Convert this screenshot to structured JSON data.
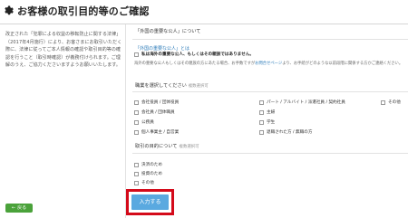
{
  "header": {
    "title": "お客様の取引目的等のご確認"
  },
  "notice": {
    "text": "改正された「犯罪による収益の移転防止に関する法律」（2017年4月施行）により、お客さまにお取引いただく際に、法律に従ってご本人情報の確認や取引目的等の確認を行うこと（取引時確認）が義務付けられます。ご理解のうえ、ご協力くださいますようお願いいたします。"
  },
  "back_button": {
    "label": "戻る"
  },
  "pep": {
    "heading": "「外国の重要な公人」について",
    "link": "「外国の重要な公人」とは",
    "declaration": "私は海外の重要な公人、もしくはその親族ではありません。",
    "note_pre": "海外の重要な公人もしくはその親族の方にあたる場合、お手数ですが",
    "note_link": "お問合せページ",
    "note_post": "より、お手続がどのような以前段階に関係する方かご連絡ください。"
  },
  "occupation": {
    "heading": "職業を選択してください",
    "sub": "複数選択可",
    "options": [
      "会社役員 / 団体役員",
      "会社員 / 団体職員",
      "公務員",
      "個人事業主 / 自営業",
      "パート / アルバイト / 派遣社員 / 契約社員",
      "主婦",
      "学生",
      "退職された方 / 無職の方",
      "その他"
    ]
  },
  "purpose": {
    "heading": "取引の目的について",
    "sub": "複数選択可",
    "options": [
      "決済のため",
      "投資のため",
      "その他"
    ]
  },
  "submit": {
    "label": "入力する"
  }
}
